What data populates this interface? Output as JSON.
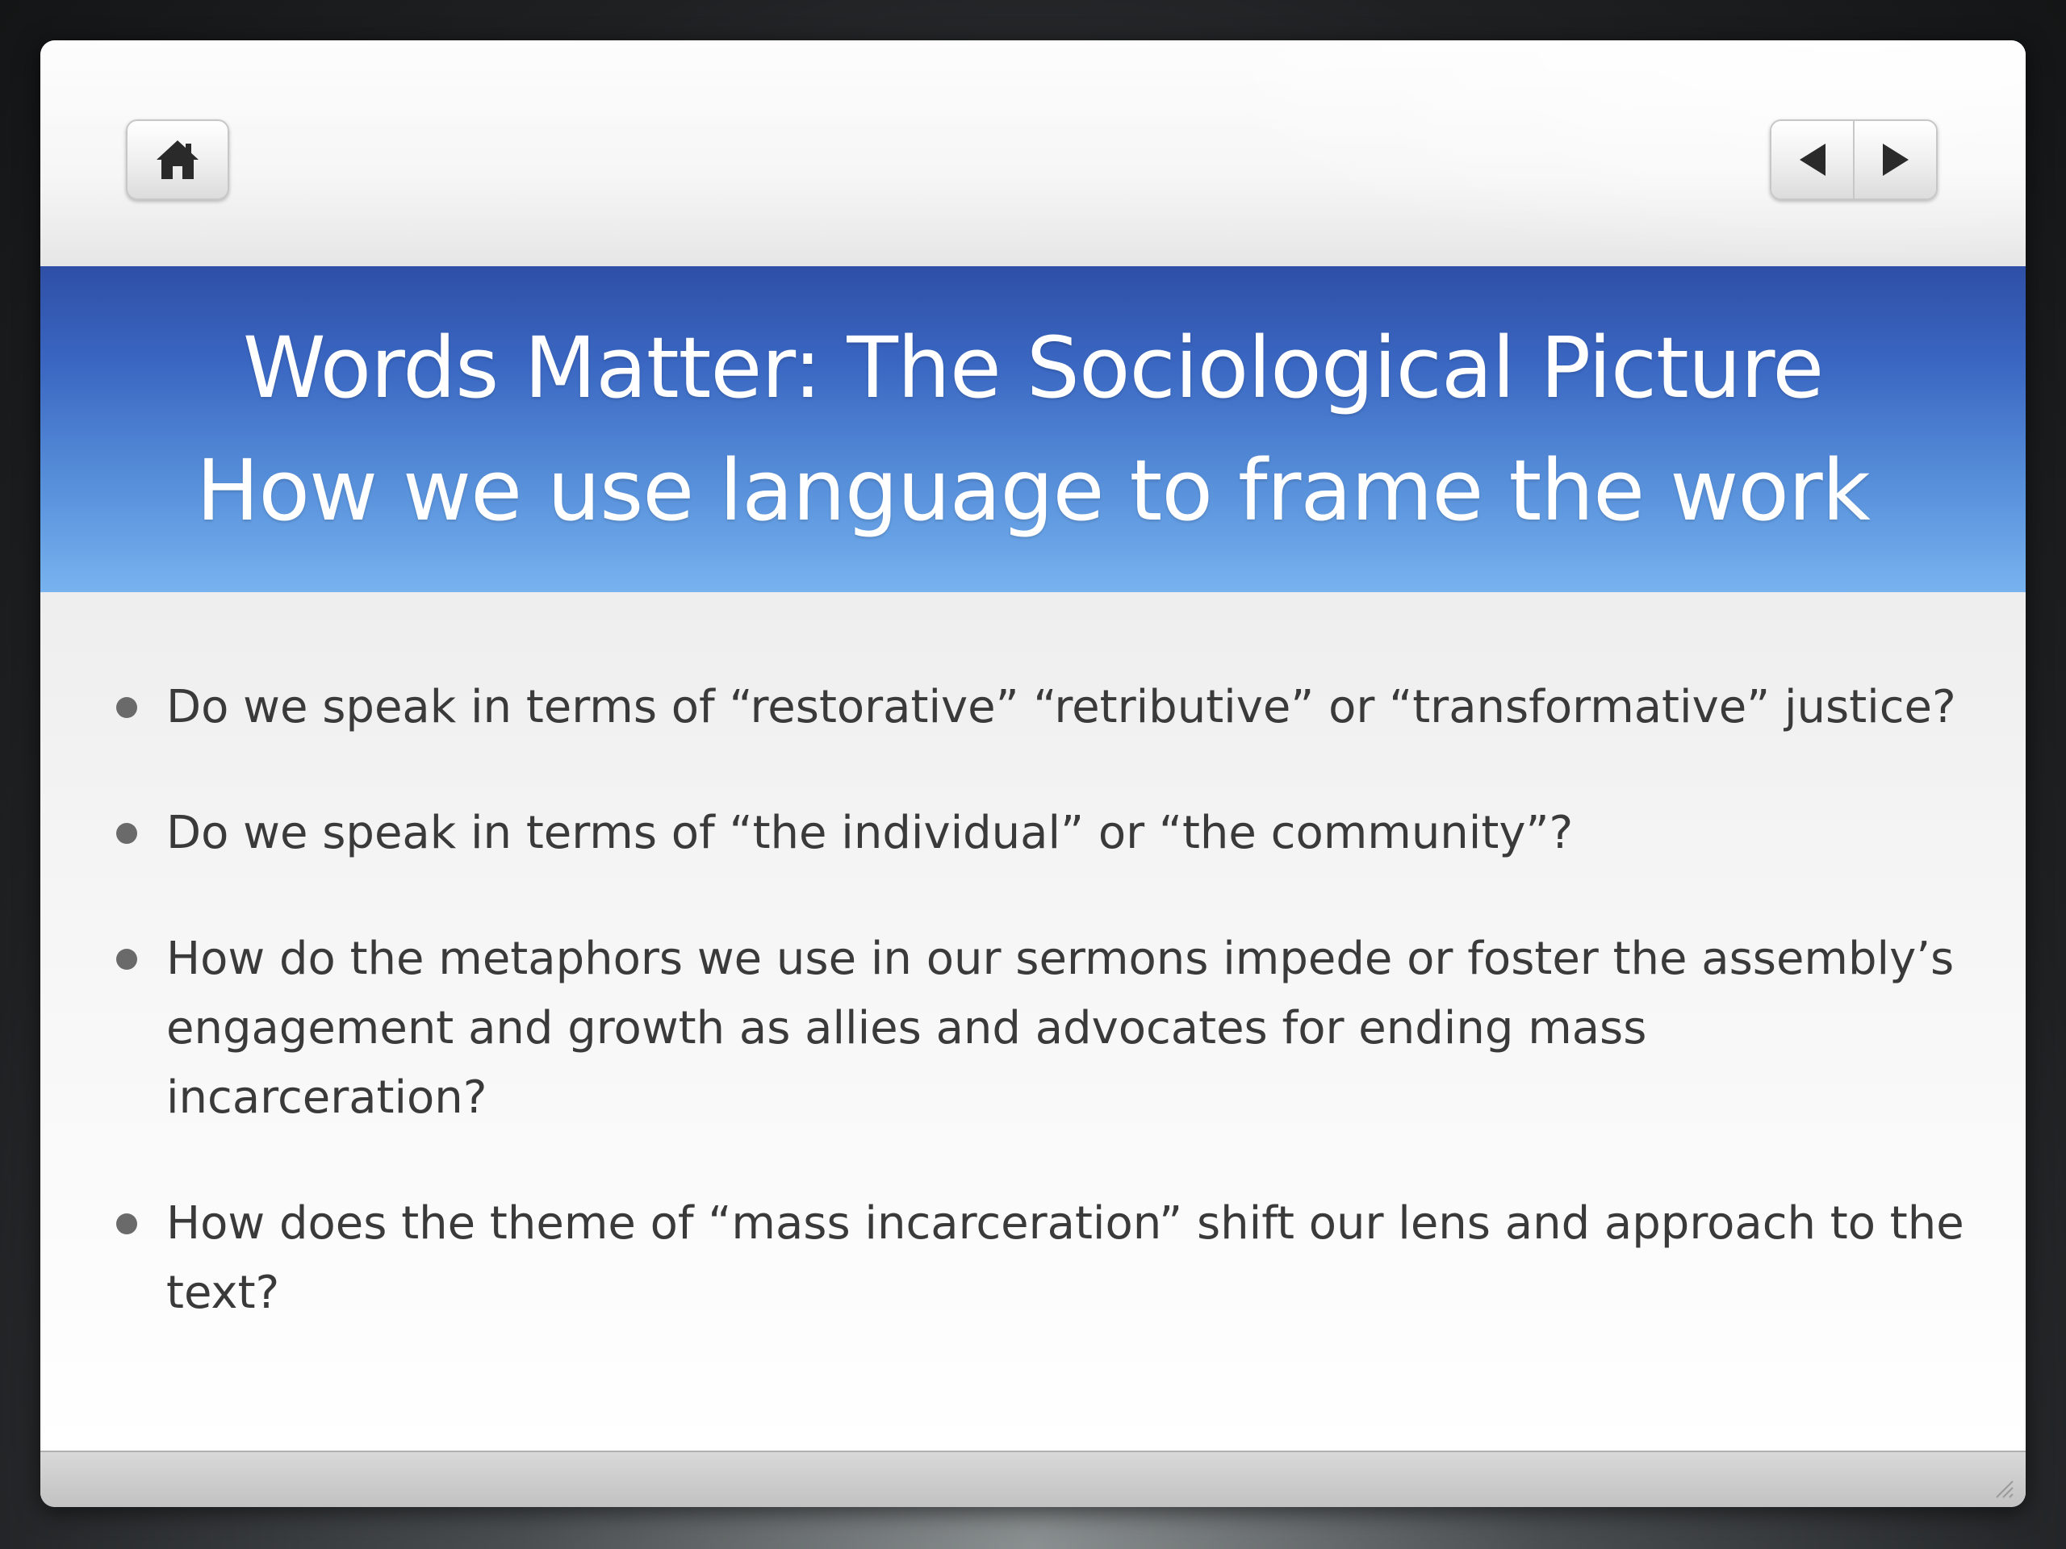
{
  "toolbar": {
    "home_icon": "home-icon",
    "prev_icon": "triangle-left-icon",
    "next_icon": "triangle-right-icon"
  },
  "slide": {
    "title_line1": "Words Matter:  The Sociological Picture",
    "title_line2": "How we use language to frame the work",
    "bullets": [
      "Do we speak in terms of  “restorative” “retributive” or “transformative” justice?",
      "Do we speak in terms of “the individual” or “the community”?",
      "How do the metaphors we use in our sermons impede or foster the assembly’s engagement and growth as allies and advocates for ending mass incarceration?",
      "How does the theme of “mass incarceration” shift our lens and approach to the text?"
    ]
  },
  "colors": {
    "title_band_top": "#2f4fa6",
    "title_band_bottom": "#78b3f0",
    "title_text": "#ffffff",
    "body_text": "#3a3a3a"
  }
}
